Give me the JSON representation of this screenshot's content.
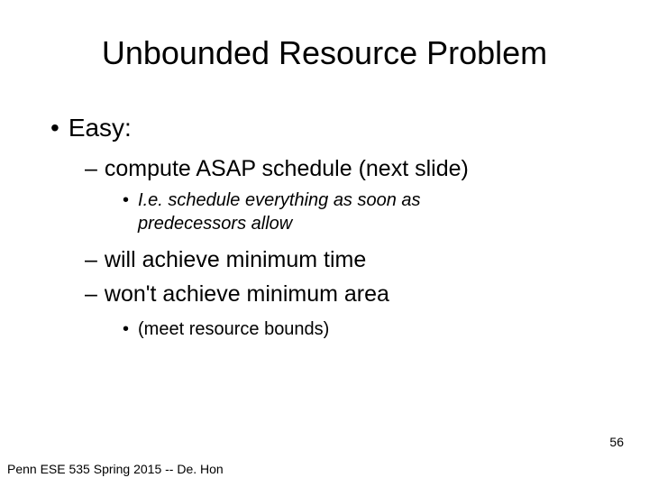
{
  "title": "Unbounded Resource Problem",
  "bullets": {
    "level1_easy": "Easy:",
    "level2_asap": "compute ASAP schedule (next slide)",
    "level3_ie": "I.e. schedule everything as soon as predecessors allow",
    "level2_min_time": "will achieve minimum time",
    "level2_min_area": "won't achieve minimum area",
    "level3_bounds": "(meet resource bounds)"
  },
  "footer": "Penn ESE 535 Spring 2015 -- De. Hon",
  "slide_number": "56"
}
